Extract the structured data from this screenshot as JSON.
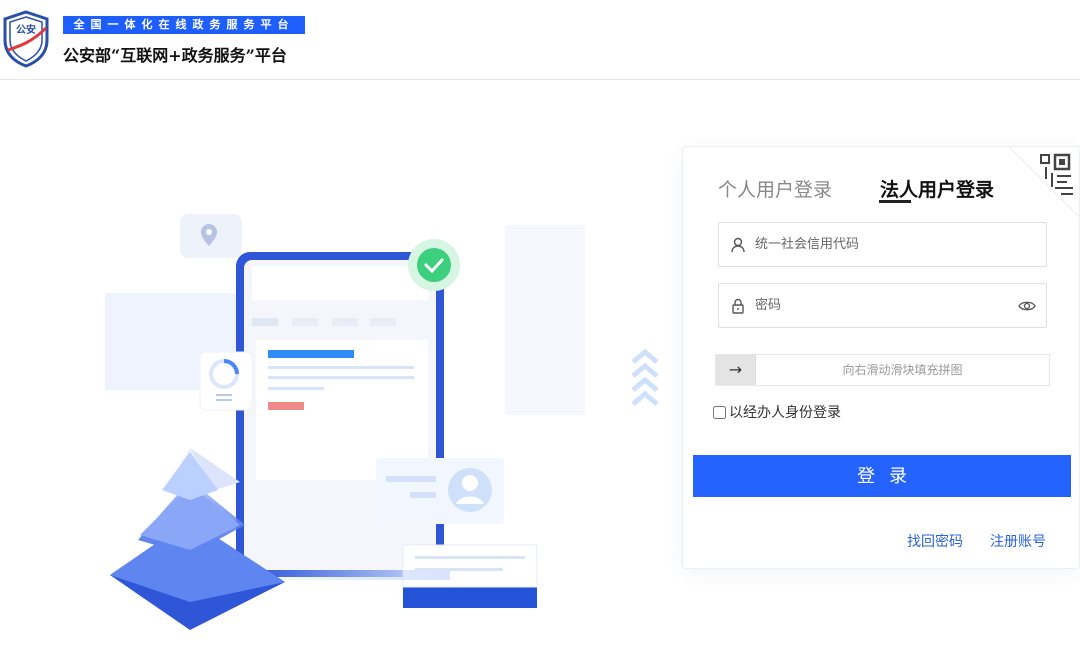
{
  "header": {
    "logo_text": "公安",
    "subtitle": "全国一体化在线政务服务平台",
    "title": "公安部“互联网+政务服务”平台"
  },
  "login": {
    "tabs": [
      {
        "label": "个人用户登录",
        "active": false
      },
      {
        "label": "法人用户登录",
        "active": true
      }
    ],
    "credit_code_placeholder": "统一社会信用代码",
    "password_placeholder": "密码",
    "slider_arrow": "→",
    "slider_hint": "向右滑动滑块填充拼图",
    "agent_checkbox_label": "以经办人身份登录",
    "agent_checked": false,
    "submit_label": "登录",
    "forgot_link": "找回密码",
    "register_link": "注册账号"
  },
  "colors": {
    "primary": "#2563ff",
    "brand_blue": "#1e5eff",
    "link": "#2a62d8"
  },
  "icons": [
    "shield-logo-icon",
    "user-icon",
    "lock-icon",
    "eye-icon",
    "qr-code-icon",
    "arrow-right-icon"
  ]
}
